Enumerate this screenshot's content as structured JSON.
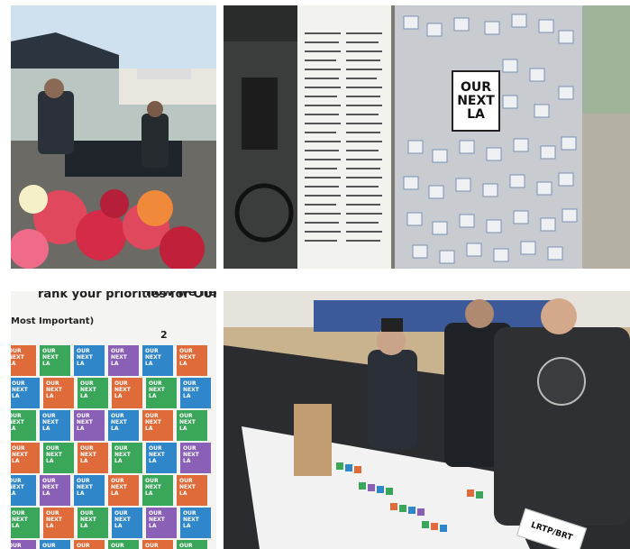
{
  "board_title": [
    "OUR",
    "NEXT",
    "LA"
  ],
  "ranking_sheet": {
    "header": "rank your priorities for OUR NEXT LA. Place each of",
    "header_tail": "how we ne",
    "most_important": "Most Important)",
    "column_number": "2"
  },
  "sticker_text": [
    "OUR",
    "NEXT",
    "LA"
  ],
  "table_tag": "LRTP/BRT",
  "colors": {
    "sticker_blue": "#2f86c8",
    "sticker_green": "#3aa65a",
    "sticker_orange": "#e06b3a",
    "sticker_purple": "#8a5fb6"
  }
}
